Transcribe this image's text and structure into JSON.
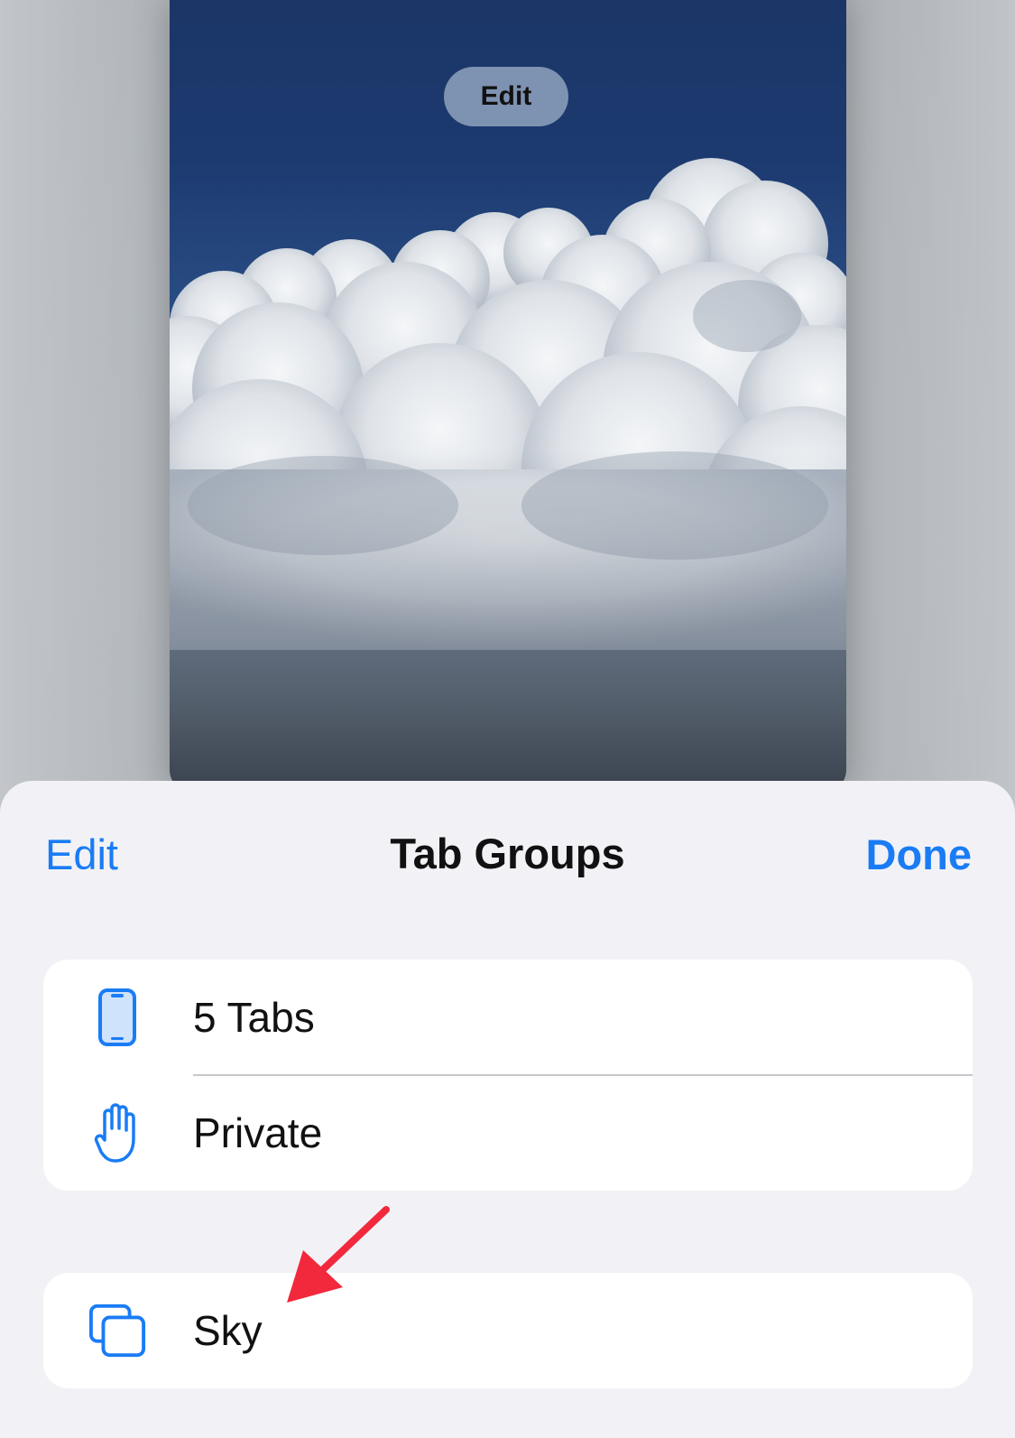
{
  "preview": {
    "edit_label": "Edit"
  },
  "sheet": {
    "title": "Tab Groups",
    "edit_label": "Edit",
    "done_label": "Done",
    "groups": [
      [
        {
          "label": "5 Tabs",
          "icon": "iphone-icon"
        },
        {
          "label": "Private",
          "icon": "hand-icon"
        }
      ],
      [
        {
          "label": "Sky",
          "icon": "tab-group-icon"
        }
      ]
    ]
  },
  "colors": {
    "accent": "#1a7cf5",
    "sheet_background": "#f2f2f6",
    "annotation_arrow": "#f2283c"
  }
}
